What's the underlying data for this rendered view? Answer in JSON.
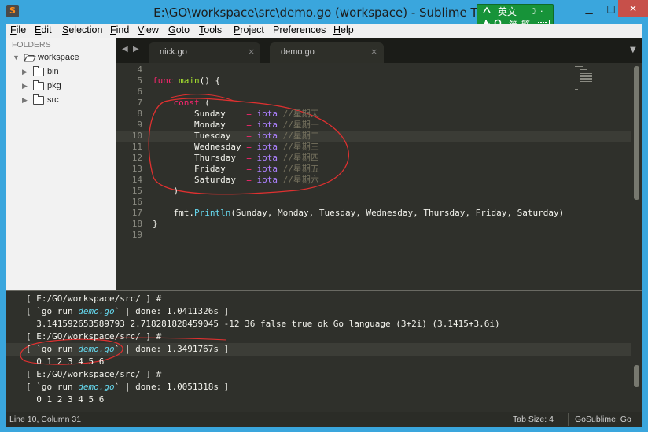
{
  "window": {
    "title": "E:\\GO\\workspace\\src\\demo.go (workspace) - Sublime Text",
    "app_icon": "sublime-text-icon",
    "minimize": "▁",
    "maximize": "□",
    "close": "✕"
  },
  "ime": {
    "language": "英文",
    "moon": "☽",
    "punct": "·",
    "script": "简",
    "full": "繁",
    "icons": [
      "ime-logo-icon",
      "hand-icon",
      "search-icon",
      "keyboard-icon"
    ]
  },
  "menu": {
    "items": [
      {
        "u": "F",
        "rest": "ile"
      },
      {
        "u": "E",
        "rest": "dit"
      },
      {
        "u": "S",
        "rest": "election"
      },
      {
        "u": "F",
        "rest": "ind"
      },
      {
        "u": "V",
        "rest": "iew"
      },
      {
        "u": "G",
        "rest": "oto"
      },
      {
        "u": "T",
        "rest": "ools"
      },
      {
        "u": "P",
        "rest": "roject"
      },
      {
        "u": "",
        "rest": "Preferences"
      },
      {
        "u": "H",
        "rest": "elp"
      }
    ]
  },
  "sidebar": {
    "label": "FOLDERS",
    "tree": [
      {
        "name": "workspace",
        "expanded": true,
        "arrow": "▼"
      },
      {
        "name": "bin",
        "expanded": false,
        "arrow": "▶"
      },
      {
        "name": "pkg",
        "expanded": false,
        "arrow": "▶"
      },
      {
        "name": "src",
        "expanded": false,
        "arrow": "▶"
      }
    ]
  },
  "tabs": {
    "nav_prev": "◀",
    "nav_next": "▶",
    "items": [
      {
        "label": "nick.go",
        "close": "×",
        "active": false
      },
      {
        "label": "demo.go",
        "close": "×",
        "active": true
      }
    ],
    "menu": "▼"
  },
  "editor": {
    "current_line": 10,
    "lines": [
      {
        "n": "4",
        "tokens": []
      },
      {
        "n": "5",
        "tokens": [
          {
            "t": "func",
            "c": "kw"
          },
          {
            "t": " ",
            "c": "id"
          },
          {
            "t": "main",
            "c": "fn"
          },
          {
            "t": "() {",
            "c": "id"
          }
        ]
      },
      {
        "n": "6",
        "tokens": []
      },
      {
        "n": "7",
        "tokens": [
          {
            "t": "    ",
            "c": "id"
          },
          {
            "t": "const",
            "c": "kw"
          },
          {
            "t": " (",
            "c": "id"
          }
        ]
      },
      {
        "n": "8",
        "tokens": [
          {
            "t": "        Sunday    ",
            "c": "id"
          },
          {
            "t": "=",
            "c": "op"
          },
          {
            "t": " ",
            "c": "id"
          },
          {
            "t": "iota",
            "c": "io"
          },
          {
            "t": " //星期天",
            "c": "cm"
          }
        ]
      },
      {
        "n": "9",
        "tokens": [
          {
            "t": "        Monday    ",
            "c": "id"
          },
          {
            "t": "=",
            "c": "op"
          },
          {
            "t": " ",
            "c": "id"
          },
          {
            "t": "iota",
            "c": "io"
          },
          {
            "t": " //星期一",
            "c": "cm"
          }
        ]
      },
      {
        "n": "10",
        "tokens": [
          {
            "t": "        Tuesday   ",
            "c": "id"
          },
          {
            "t": "=",
            "c": "op"
          },
          {
            "t": " ",
            "c": "id"
          },
          {
            "t": "iota",
            "c": "io"
          },
          {
            "t": " //星期二",
            "c": "cm"
          }
        ]
      },
      {
        "n": "11",
        "tokens": [
          {
            "t": "        Wednesday ",
            "c": "id"
          },
          {
            "t": "=",
            "c": "op"
          },
          {
            "t": " ",
            "c": "id"
          },
          {
            "t": "iota",
            "c": "io"
          },
          {
            "t": " //星期三",
            "c": "cm"
          }
        ]
      },
      {
        "n": "12",
        "tokens": [
          {
            "t": "        Thursday  ",
            "c": "id"
          },
          {
            "t": "=",
            "c": "op"
          },
          {
            "t": " ",
            "c": "id"
          },
          {
            "t": "iota",
            "c": "io"
          },
          {
            "t": " //星期四",
            "c": "cm"
          }
        ]
      },
      {
        "n": "13",
        "tokens": [
          {
            "t": "        Friday    ",
            "c": "id"
          },
          {
            "t": "=",
            "c": "op"
          },
          {
            "t": " ",
            "c": "id"
          },
          {
            "t": "iota",
            "c": "io"
          },
          {
            "t": " //星期五",
            "c": "cm"
          }
        ]
      },
      {
        "n": "14",
        "tokens": [
          {
            "t": "        Saturday  ",
            "c": "id"
          },
          {
            "t": "=",
            "c": "op"
          },
          {
            "t": " ",
            "c": "id"
          },
          {
            "t": "iota",
            "c": "io"
          },
          {
            "t": " //星期六",
            "c": "cm"
          }
        ]
      },
      {
        "n": "15",
        "tokens": [
          {
            "t": "    )",
            "c": "id"
          }
        ]
      },
      {
        "n": "16",
        "tokens": []
      },
      {
        "n": "17",
        "tokens": [
          {
            "t": "    fmt.",
            "c": "id"
          },
          {
            "t": "Println",
            "c": "call"
          },
          {
            "t": "(Sunday, Monday, Tuesday, Wednesday, Thursday, Friday, Saturday)",
            "c": "id"
          }
        ]
      },
      {
        "n": "18",
        "tokens": [
          {
            "t": "}",
            "c": "id"
          }
        ]
      },
      {
        "n": "19",
        "tokens": []
      }
    ]
  },
  "console": {
    "lines": [
      {
        "parts": [
          {
            "t": "[ E:/GO/workspace/src/ ] #",
            "c": ""
          }
        ],
        "hl": false
      },
      {
        "parts": [
          {
            "t": "[ `go run ",
            "c": ""
          },
          {
            "t": "demo.go",
            "c": "con-italic"
          },
          {
            "t": "` | done: 1.0411326s ]",
            "c": ""
          }
        ],
        "hl": false
      },
      {
        "parts": [
          {
            "t": "  3.141592653589793 2.718281828459045 -12 36 false true ok Go language (3+2i) (3.1415+3.6i)",
            "c": ""
          }
        ],
        "hl": false
      },
      {
        "parts": [
          {
            "t": "[ E:/GO/workspace/src/ ] #",
            "c": ""
          }
        ],
        "hl": false
      },
      {
        "parts": [
          {
            "t": "[ `go run ",
            "c": ""
          },
          {
            "t": "demo.go",
            "c": "con-italic"
          },
          {
            "t": "` | done: 1.3491767s ]",
            "c": ""
          }
        ],
        "hl": true
      },
      {
        "parts": [
          {
            "t": "  0 1 2 3 4 5 6",
            "c": ""
          }
        ],
        "hl": false
      },
      {
        "parts": [
          {
            "t": "[ E:/GO/workspace/src/ ] #",
            "c": ""
          }
        ],
        "hl": false
      },
      {
        "parts": [
          {
            "t": "[ `go run ",
            "c": ""
          },
          {
            "t": "demo.go",
            "c": "con-italic"
          },
          {
            "t": "` | done: 1.0051318s ]",
            "c": ""
          }
        ],
        "hl": false
      },
      {
        "parts": [
          {
            "t": "  0 1 2 3 4 5 6",
            "c": ""
          }
        ],
        "hl": false
      }
    ]
  },
  "status": {
    "position": "Line 10, Column 31",
    "tab_size": "Tab Size: 4",
    "syntax": "GoSublime: Go"
  },
  "colors": {
    "keyword": "#f7266e",
    "function": "#a6e22e",
    "constant": "#ad81ff",
    "comment": "#75715e",
    "annotation": "#e03030"
  }
}
